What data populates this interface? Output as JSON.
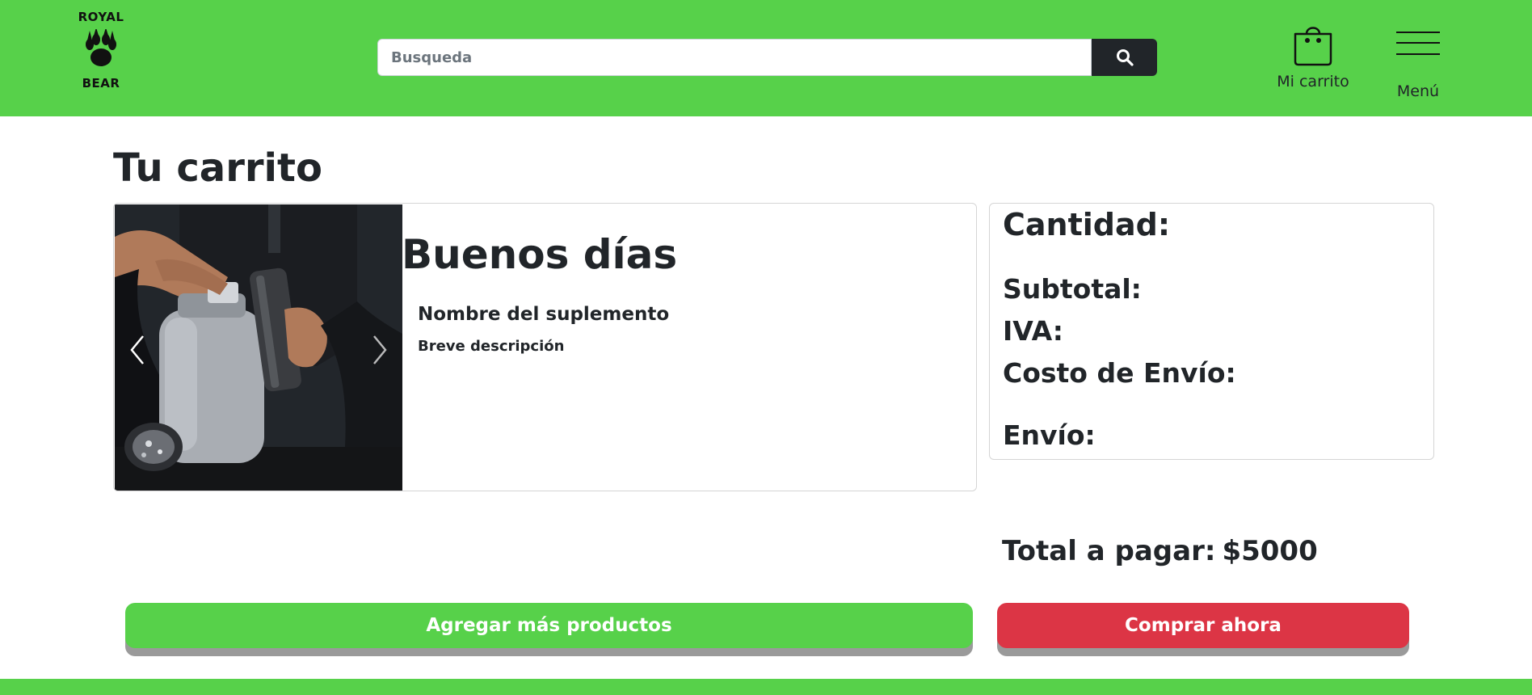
{
  "header": {
    "logo_top": "ROYAL",
    "logo_bottom": "BEAR",
    "search_placeholder": "Busqueda",
    "cart_label": "Mi carrito",
    "menu_label": "Menú"
  },
  "page": {
    "title": "Tu carrito"
  },
  "product": {
    "greeting": "Buenos días",
    "name": "Nombre del suplemento",
    "description": "Breve descripción"
  },
  "summary": {
    "quantity_label": "Cantidad:",
    "subtotal_label": "Subtotal:",
    "iva_label": "IVA:",
    "shipping_cost_label": "Costo de Envío:",
    "shipping_label": "Envío:"
  },
  "total": {
    "label": "Total a pagar:",
    "amount": "$5000"
  },
  "actions": {
    "add_more": "Agregar más productos",
    "buy_now": "Comprar ahora"
  },
  "colors": {
    "brand_green": "#57d14a",
    "buy_red": "#dc3545",
    "dark": "#212529"
  },
  "icons": {
    "logo": "paw-icon",
    "search": "search-icon",
    "cart": "shopping-bag-icon",
    "menu": "hamburger-icon",
    "carousel_prev": "chevron-left-icon",
    "carousel_next": "chevron-right-icon"
  }
}
